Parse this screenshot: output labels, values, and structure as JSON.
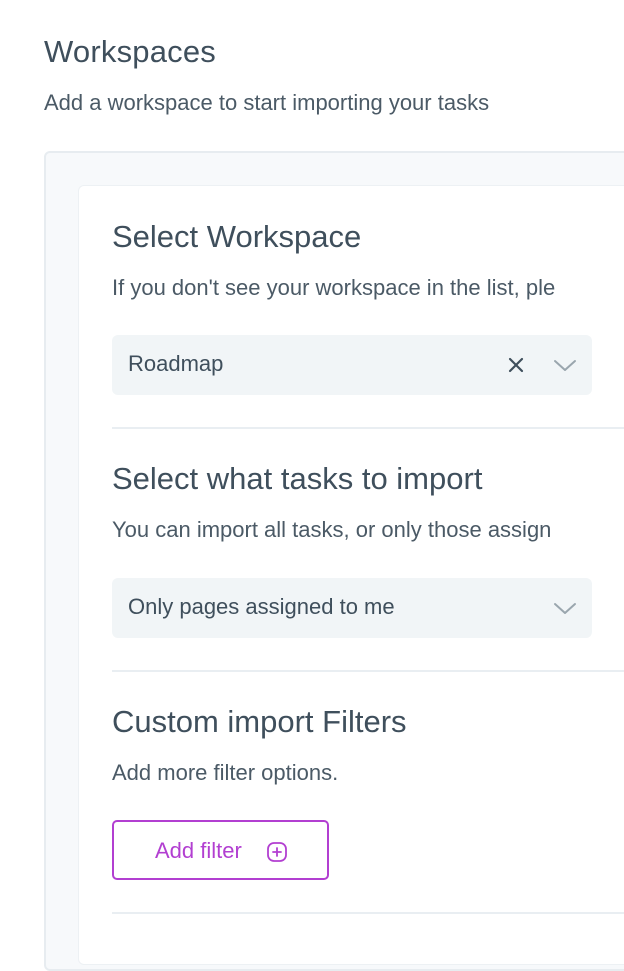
{
  "header": {
    "title": "Workspaces",
    "subtitle": "Add a workspace to start importing your tasks"
  },
  "workspace_section": {
    "title": "Select Workspace",
    "description": "If you don't see your workspace in the list, ple",
    "select": {
      "value": "Roadmap",
      "clear_icon": "close-icon",
      "dropdown_icon": "chevron-down-icon"
    }
  },
  "tasks_section": {
    "title": "Select what tasks to import",
    "description": "You can import all tasks, or only those assign",
    "select": {
      "value": "Only pages assigned to me",
      "dropdown_icon": "chevron-down-icon"
    }
  },
  "filters_section": {
    "title": "Custom import Filters",
    "description": "Add more filter options.",
    "add_button_label": "Add filter",
    "add_button_icon": "plus-circle-icon"
  },
  "colors": {
    "accent": "#b23fd1",
    "text": "#3f4f5c",
    "select_bg": "#f1f5f7",
    "panel_bg": "#f7f9fb"
  }
}
